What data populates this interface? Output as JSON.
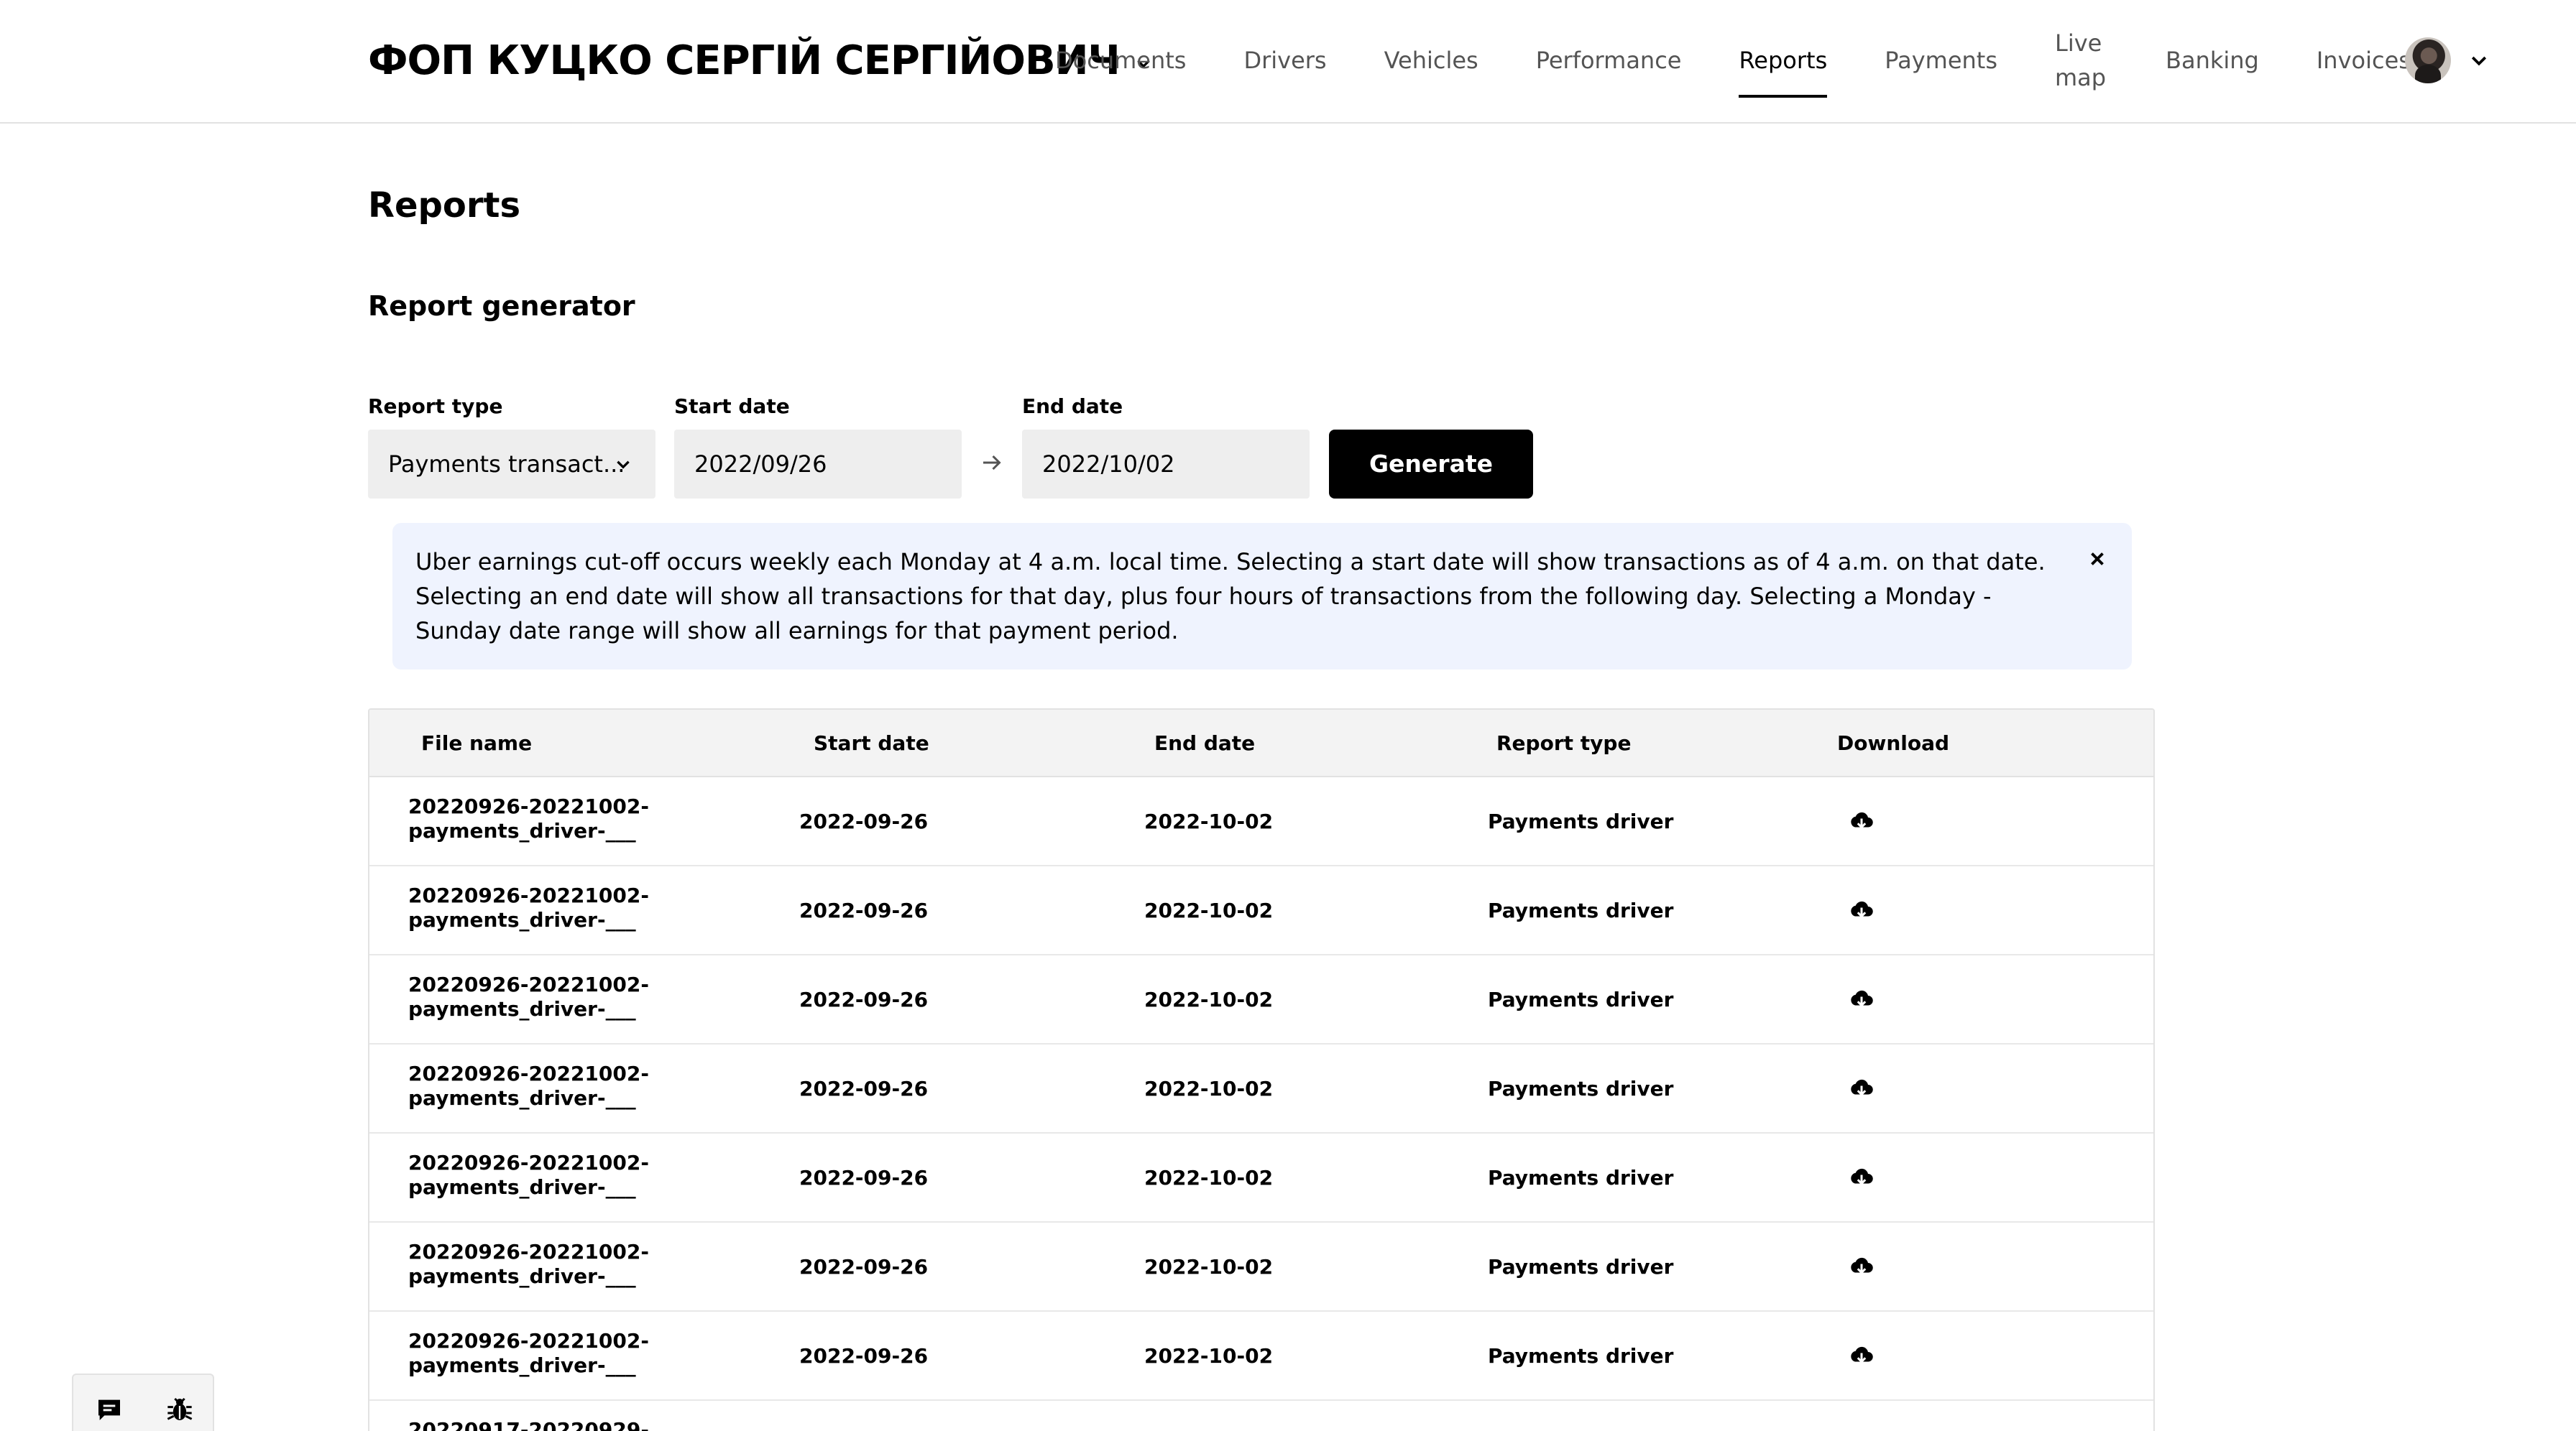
{
  "header": {
    "org_name": "ФОП КУЦКО СЕРГІЙ СЕРГІЙОВИЧ",
    "nav": [
      {
        "label": "Documents",
        "active": false
      },
      {
        "label": "Drivers",
        "active": false
      },
      {
        "label": "Vehicles",
        "active": false
      },
      {
        "label": "Performance",
        "active": false
      },
      {
        "label": "Reports",
        "active": true
      },
      {
        "label": "Payments",
        "active": false
      },
      {
        "label": "Live map",
        "active": false
      },
      {
        "label": "Banking",
        "active": false
      },
      {
        "label": "Invoices",
        "active": false
      }
    ]
  },
  "page": {
    "title": "Reports",
    "section_title": "Report generator"
  },
  "form": {
    "report_type_label": "Report type",
    "report_type_value": "Payments transact...",
    "start_date_label": "Start date",
    "start_date_value": "2022/09/26",
    "end_date_label": "End date",
    "end_date_value": "2022/10/02",
    "generate_label": "Generate"
  },
  "banner": {
    "text": "Uber earnings cut-off occurs weekly each Monday at 4 a.m. local time. Selecting a start date will show transactions as of 4 a.m. on that date. Selecting an end date will show all transactions for that day, plus four hours of transactions from the following day. Selecting a Monday - Sunday date range will show all earnings for that payment period."
  },
  "table": {
    "headers": {
      "file_name": "File name",
      "start_date": "Start date",
      "end_date": "End date",
      "report_type": "Report type",
      "download": "Download"
    },
    "rows": [
      {
        "file_name": "20220926-20221002-payments_driver-___",
        "start_date": "2022-09-26",
        "end_date": "2022-10-02",
        "report_type": "Payments driver"
      },
      {
        "file_name": "20220926-20221002-payments_driver-___",
        "start_date": "2022-09-26",
        "end_date": "2022-10-02",
        "report_type": "Payments driver"
      },
      {
        "file_name": "20220926-20221002-payments_driver-___",
        "start_date": "2022-09-26",
        "end_date": "2022-10-02",
        "report_type": "Payments driver"
      },
      {
        "file_name": "20220926-20221002-payments_driver-___",
        "start_date": "2022-09-26",
        "end_date": "2022-10-02",
        "report_type": "Payments driver"
      },
      {
        "file_name": "20220926-20221002-payments_driver-___",
        "start_date": "2022-09-26",
        "end_date": "2022-10-02",
        "report_type": "Payments driver"
      },
      {
        "file_name": "20220926-20221002-payments_driver-___",
        "start_date": "2022-09-26",
        "end_date": "2022-10-02",
        "report_type": "Payments driver"
      },
      {
        "file_name": "20220926-20221002-payments_driver-___",
        "start_date": "2022-09-26",
        "end_date": "2022-10-02",
        "report_type": "Payments driver"
      },
      {
        "file_name": "20220917-20220929-",
        "start_date": "",
        "end_date": "",
        "report_type": ""
      }
    ]
  },
  "icons": {
    "org_switcher": "chevron-down-icon",
    "user_menu": "chevron-down-icon",
    "date_arrow": "arrow-right-icon",
    "banner_close": "close-icon",
    "download": "cloud-download-icon",
    "feedback": "chat-icon",
    "bug_report": "bug-icon"
  }
}
